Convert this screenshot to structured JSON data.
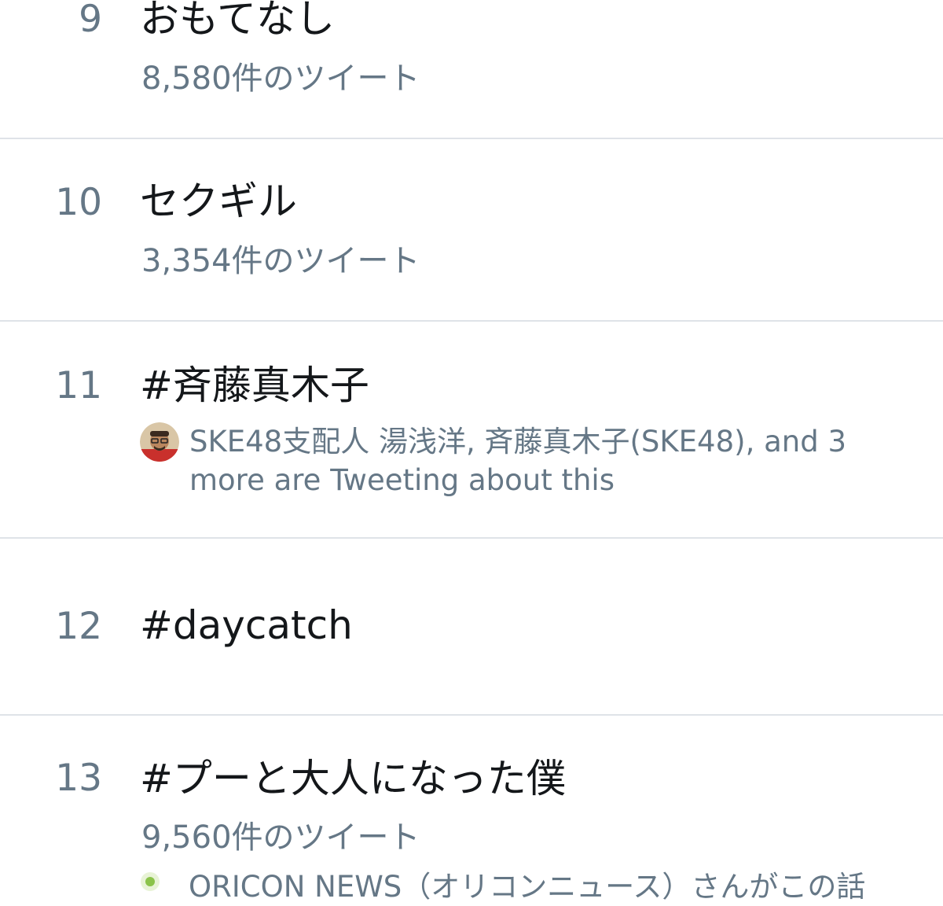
{
  "trends": [
    {
      "rank": "9",
      "title": "おもてなし",
      "meta": "8,580件のツイート"
    },
    {
      "rank": "10",
      "title": "セクギル",
      "meta": "3,354件のツイート"
    },
    {
      "rank": "11",
      "title": "#斉藤真木子",
      "context": "SKE48支配人 湯浅洋, 斉藤真木子(SKE48), and 3 more are Tweeting about this"
    },
    {
      "rank": "12",
      "title": "#daycatch"
    },
    {
      "rank": "13",
      "title": "#プーと大人になった僕",
      "meta": "9,560件のツイート"
    }
  ],
  "partial_row_text": "ORICON NEWS（オリコンニュース）さんがこの話",
  "colors": {
    "primary_text": "#14171a",
    "secondary_text": "#657786",
    "divider": "#dfe3e8",
    "background": "#ffffff"
  },
  "icons": {
    "context_avatar": "avatar-icon",
    "partial_avatar": "avatar-icon"
  }
}
